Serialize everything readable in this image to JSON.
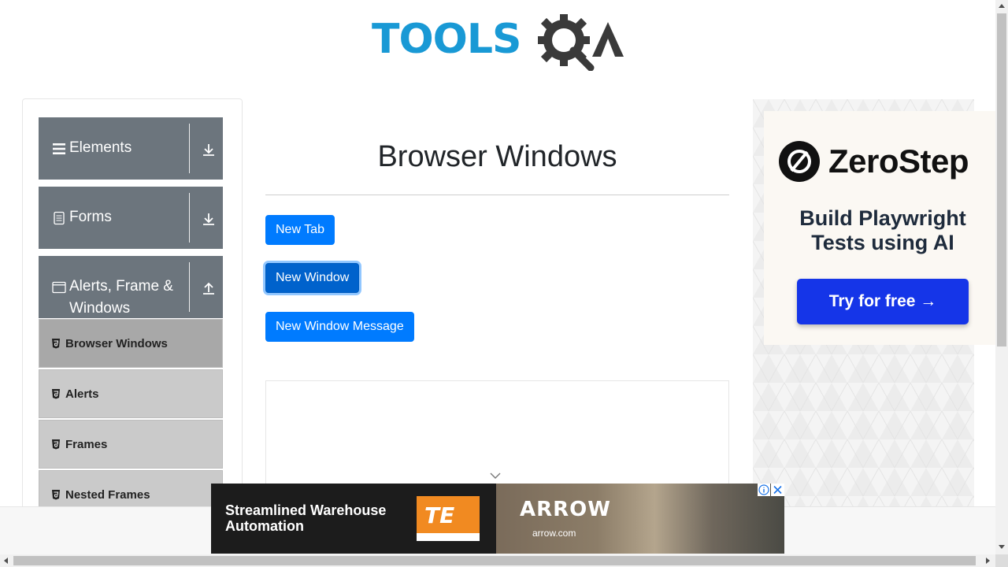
{
  "header": {
    "logo_text": "TOOLS",
    "logo_accent": "QA",
    "brand_color": "#1999d5"
  },
  "sidebar": {
    "groups": [
      {
        "title": "Elements",
        "icon": "hamburger-icon",
        "arrow": "download-arrow-icon"
      },
      {
        "title": "Forms",
        "icon": "document-icon",
        "arrow": "download-arrow-icon"
      },
      {
        "title": "Alerts, Frame & Windows",
        "title_line1": "Alerts, Frame &",
        "title_line2": "Windows",
        "icon": "window-icon",
        "arrow": "upload-arrow-icon"
      }
    ],
    "items": [
      {
        "label": "Browser Windows",
        "active": true
      },
      {
        "label": "Alerts",
        "active": false
      },
      {
        "label": "Frames",
        "active": false
      },
      {
        "label": "Nested Frames",
        "active": false
      }
    ]
  },
  "main": {
    "title": "Browser Windows",
    "buttons": {
      "new_tab": "New Tab",
      "new_window": "New Window",
      "new_window_message": "New Window Message"
    },
    "accent_color": "#007bff"
  },
  "right_ad": {
    "brand": "ZeroStep",
    "tagline_line1": "Build Playwright",
    "tagline_line2": "Tests using AI",
    "cta": "Try for free →",
    "cta_color": "#1535e8"
  },
  "bottom_ad": {
    "headline_line1": "Streamlined Warehouse",
    "headline_line2": "Automation",
    "te_logo": "TE",
    "arrow_logo": "ARROW",
    "arrow_url": "arrow.com"
  }
}
